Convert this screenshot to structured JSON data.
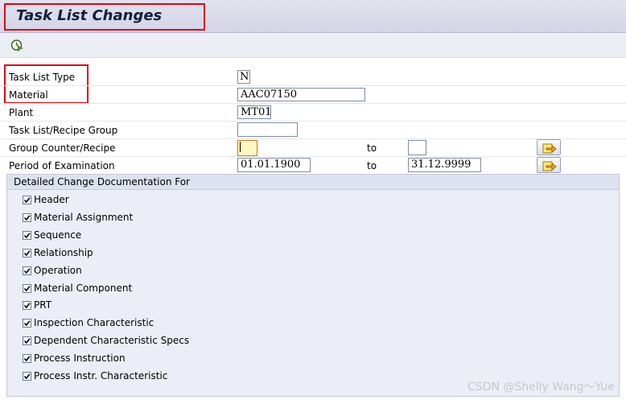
{
  "window": {
    "title": "Task List Changes"
  },
  "toolbar": {
    "execute_icon": "execute-clock-icon"
  },
  "form": {
    "task_list_type": {
      "label": "Task List Type",
      "value": "N"
    },
    "material": {
      "label": "Material",
      "value": "AAC07150"
    },
    "plant": {
      "label": "Plant",
      "value": "MT01"
    },
    "group": {
      "label": "Task List/Recipe Group",
      "value": ""
    },
    "group_counter": {
      "label": "Group Counter/Recipe",
      "from": "",
      "to_label": "to",
      "to": ""
    },
    "period": {
      "label": "Period of Examination",
      "from": "01.01.1900",
      "to_label": "to",
      "to": "31.12.9999"
    },
    "multiple_selection_icon": "multiple-selection-arrow-icon"
  },
  "change_docs": {
    "title": "Detailed Change Documentation For",
    "items": [
      {
        "label": "Header",
        "checked": true
      },
      {
        "label": "Material Assignment",
        "checked": true
      },
      {
        "label": "Sequence",
        "checked": true
      },
      {
        "label": "Relationship",
        "checked": true
      },
      {
        "label": "Operation",
        "checked": true
      },
      {
        "label": "Material Component",
        "checked": true
      },
      {
        "label": "PRT",
        "checked": true
      },
      {
        "label": "Inspection Characteristic",
        "checked": true
      },
      {
        "label": "Dependent Characteristic Specs",
        "checked": true
      },
      {
        "label": "Process Instruction",
        "checked": true
      },
      {
        "label": "Process Instr. Characteristic",
        "checked": true
      }
    ]
  },
  "watermark": "CSDN @Shelly Wang～Yue",
  "colors": {
    "highlight_box": "#e60012",
    "title": "#10203e",
    "group_bg": "#eceef7"
  }
}
